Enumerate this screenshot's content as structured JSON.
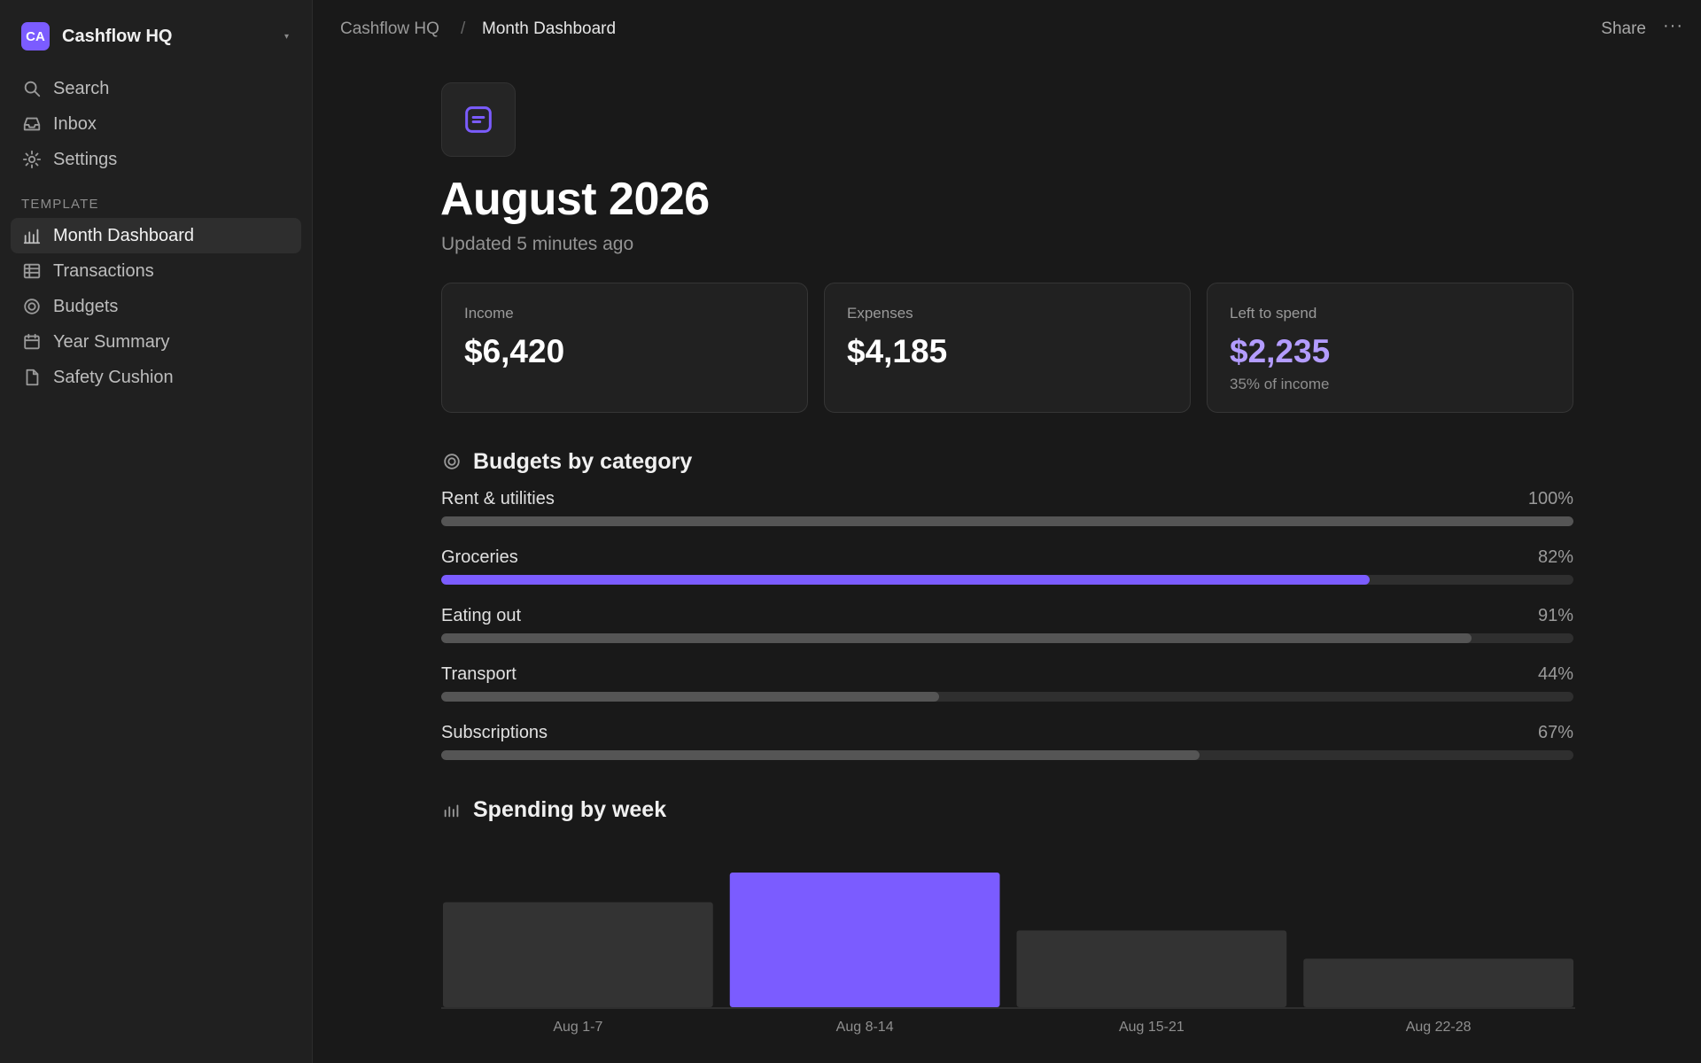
{
  "workspace": {
    "initials": "CA",
    "name": "Cashflow HQ"
  },
  "nav_top": [
    {
      "label": "Search",
      "icon": "search-icon"
    },
    {
      "label": "Inbox",
      "icon": "inbox-icon"
    },
    {
      "label": "Settings",
      "icon": "gear-icon"
    }
  ],
  "section_label": "TEMPLATE",
  "nav_pages": [
    {
      "label": "Month Dashboard",
      "icon": "bar-chart-icon",
      "active": true
    },
    {
      "label": "Transactions",
      "icon": "table-icon"
    },
    {
      "label": "Budgets",
      "icon": "target-icon"
    },
    {
      "label": "Year Summary",
      "icon": "calendar-icon"
    },
    {
      "label": "Safety Cushion",
      "icon": "file-icon"
    }
  ],
  "breadcrumb": {
    "root": "Cashflow HQ",
    "separator": "/",
    "current": "Month Dashboard"
  },
  "topbar": {
    "share": "Share",
    "more": "···"
  },
  "page": {
    "title": "August 2026",
    "subtitle": "Updated 5 minutes ago"
  },
  "cards": [
    {
      "label": "Income",
      "value": "$6,420",
      "note": ""
    },
    {
      "label": "Expenses",
      "value": "$4,185",
      "note": ""
    },
    {
      "label": "Left to spend",
      "value": "$2,235",
      "note": "35% of income"
    }
  ],
  "budgets": {
    "heading": "Budgets by category",
    "items": [
      {
        "name": "Rent & utilities",
        "pct_label": "100%",
        "fraction": 1.0,
        "highlight": false
      },
      {
        "name": "Groceries",
        "pct_label": "82%",
        "fraction": 0.82,
        "highlight": true
      },
      {
        "name": "Eating out",
        "pct_label": "91%",
        "fraction": 0.91,
        "highlight": false
      },
      {
        "name": "Transport",
        "pct_label": "44%",
        "fraction": 0.44,
        "highlight": false
      },
      {
        "name": "Subscriptions",
        "pct_label": "67%",
        "fraction": 0.67,
        "highlight": false
      }
    ]
  },
  "spending": {
    "heading": "Spending by week"
  },
  "colors": {
    "accent": "#7b5cff",
    "accent_text": "#b39cff",
    "bar_default": "#333333",
    "background": "#191919"
  },
  "chart_data": {
    "type": "bar",
    "categories": [
      "Aug 1-7",
      "Aug 8-14",
      "Aug 15-21",
      "Aug 22-28"
    ],
    "values": [
      0.78,
      1.0,
      0.57,
      0.36
    ],
    "highlight_index": 1,
    "ylim": [
      0,
      1
    ],
    "grid": false,
    "title": "",
    "xlabel": "",
    "ylabel": ""
  }
}
